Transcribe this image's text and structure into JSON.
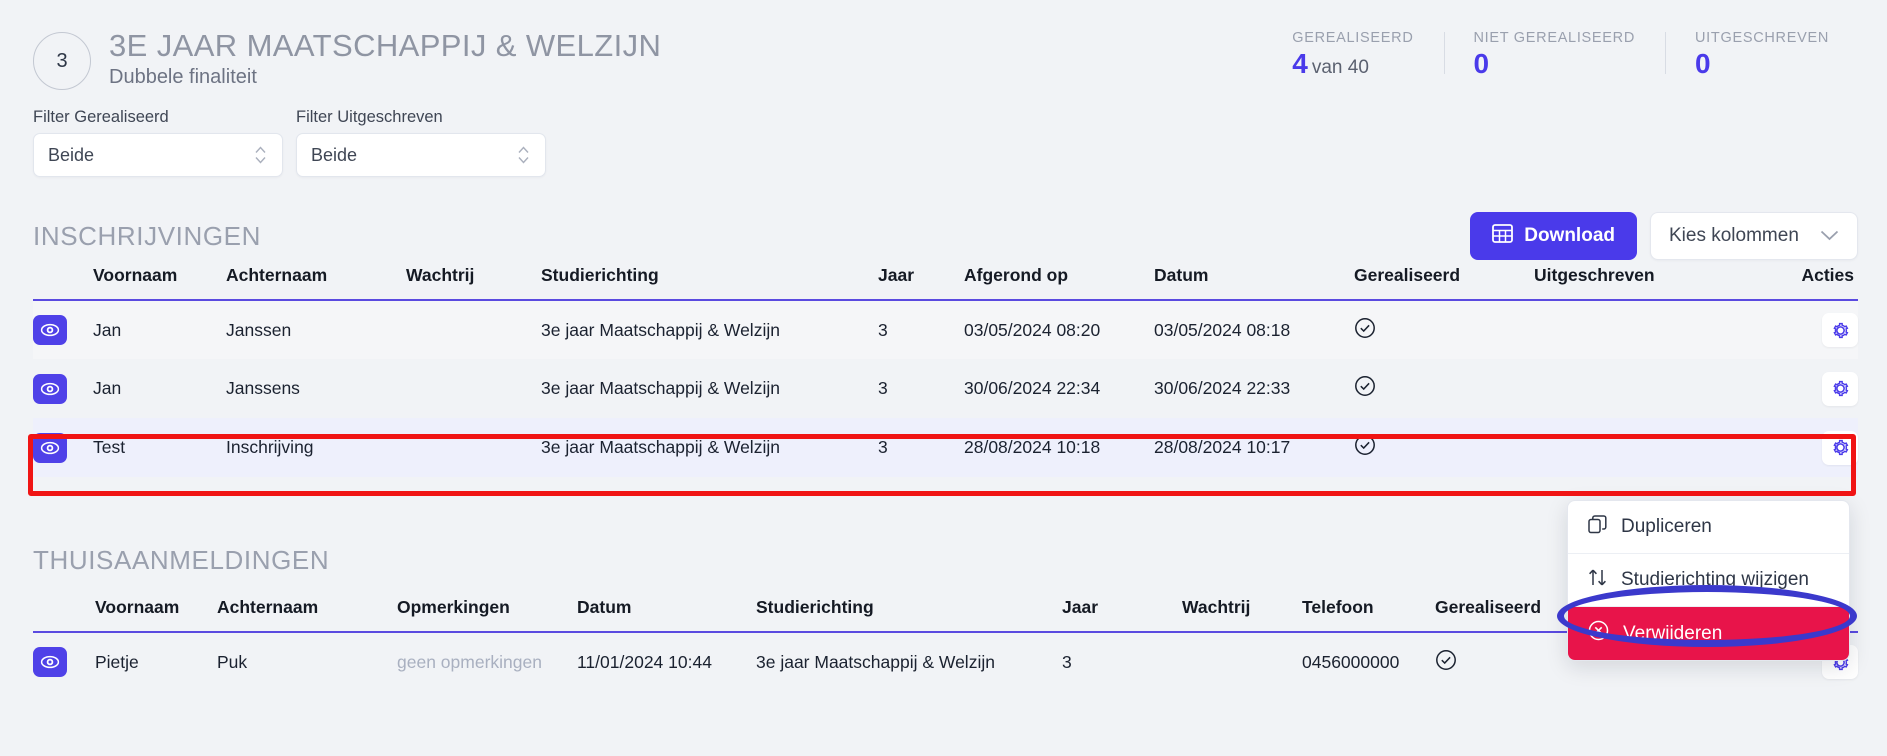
{
  "header": {
    "year_badge": "3",
    "title": "3E JAAR MAATSCHAPPIJ & WELZIJN",
    "subtitle": "Dubbele finaliteit",
    "stats": [
      {
        "label": "GEREALISEERD",
        "value": "4",
        "suffix": "van 40"
      },
      {
        "label": "NIET GEREALISEERD",
        "value": "0",
        "suffix": ""
      },
      {
        "label": "UITGESCHREVEN",
        "value": "0",
        "suffix": ""
      }
    ]
  },
  "filters": [
    {
      "label": "Filter Gerealiseerd",
      "value": "Beide"
    },
    {
      "label": "Filter Uitgeschreven",
      "value": "Beide"
    }
  ],
  "inschrijvingen": {
    "heading": "INSCHRIJVINGEN",
    "download_label": "Download",
    "columns_label": "Kies kolommen",
    "headers": [
      "Voornaam",
      "Achternaam",
      "Wachtrij",
      "Studierichting",
      "Jaar",
      "Afgerond op",
      "Datum",
      "Gerealiseerd",
      "Uitgeschreven",
      "Acties"
    ],
    "rows": [
      {
        "voornaam": "Jan",
        "achternaam": "Janssen",
        "wachtrij": "",
        "studierichting": "3e jaar Maatschappij & Welzijn",
        "jaar": "3",
        "afgerond_op": "03/05/2024 08:20",
        "datum": "03/05/2024 08:18",
        "gerealiseerd": "check",
        "uitgeschreven": ""
      },
      {
        "voornaam": "Jan",
        "achternaam": "Janssens",
        "wachtrij": "",
        "studierichting": "3e jaar Maatschappij & Welzijn",
        "jaar": "3",
        "afgerond_op": "30/06/2024 22:34",
        "datum": "30/06/2024 22:33",
        "gerealiseerd": "check",
        "uitgeschreven": ""
      },
      {
        "voornaam": "Test",
        "achternaam": "Inschrijving",
        "wachtrij": "",
        "studierichting": "3e jaar Maatschappij & Welzijn",
        "jaar": "3",
        "afgerond_op": "28/08/2024 10:18",
        "datum": "28/08/2024 10:17",
        "gerealiseerd": "check",
        "uitgeschreven": ""
      }
    ]
  },
  "thuisaanmeldingen": {
    "heading": "THUISAANMELDINGEN",
    "headers": [
      "Voornaam",
      "Achternaam",
      "Opmerkingen",
      "Datum",
      "Studierichting",
      "Jaar",
      "Wachtrij",
      "Telefoon",
      "Gerealiseerd"
    ],
    "rows": [
      {
        "voornaam": "Pietje",
        "achternaam": "Puk",
        "opmerkingen": "geen opmerkingen",
        "datum": "11/01/2024 10:44",
        "studierichting": "3e jaar Maatschappij & Welzijn",
        "jaar": "3",
        "wachtrij": "",
        "telefoon": "0456000000",
        "gerealiseerd": "check"
      }
    ]
  },
  "context_menu": {
    "items": [
      {
        "label": "Dupliceren",
        "icon": "copy-icon"
      },
      {
        "label": "Studierichting wijzigen",
        "icon": "swap-arrows-icon"
      },
      {
        "label": "Verwijderen",
        "icon": "circle-x-icon"
      }
    ]
  },
  "colors": {
    "accent": "#4a3aea",
    "danger": "#e8144a",
    "annotation_rect": "#f01414",
    "annotation_ellipse": "#3b39cc"
  }
}
